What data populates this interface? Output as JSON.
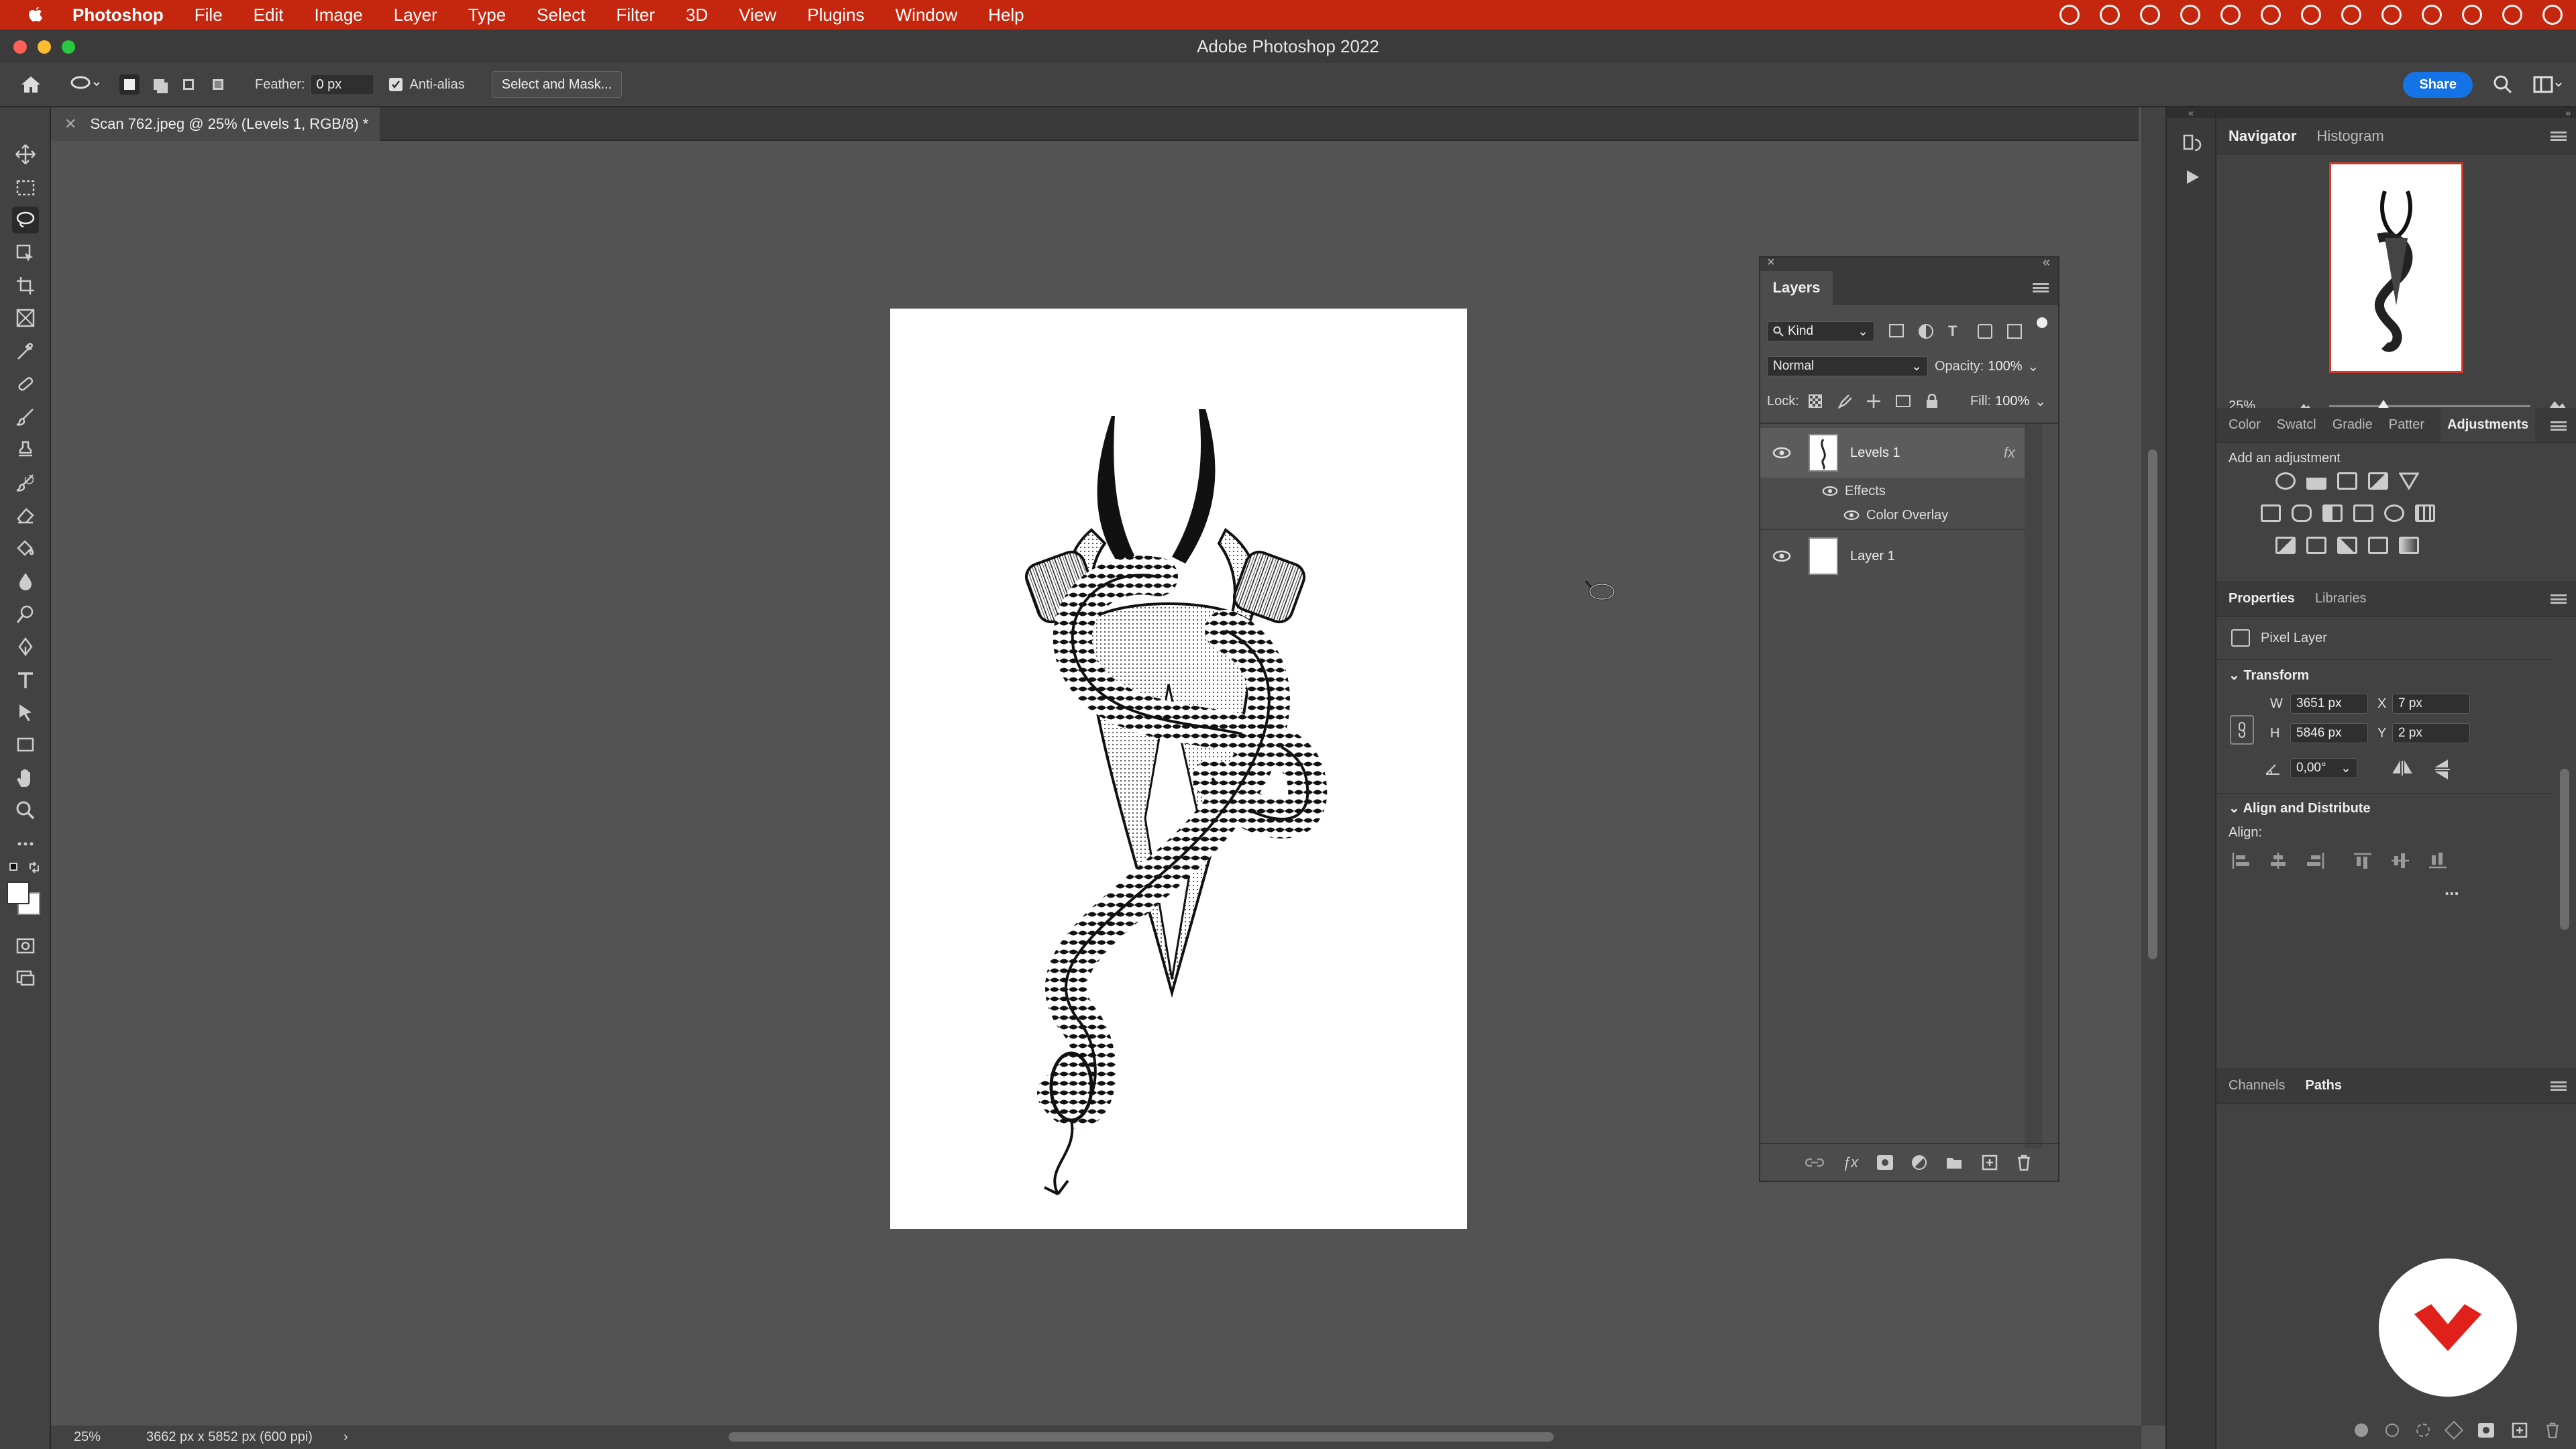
{
  "menubar": {
    "app_name": "Photoshop",
    "items": [
      "File",
      "Edit",
      "Image",
      "Layer",
      "Type",
      "Select",
      "Filter",
      "3D",
      "View",
      "Plugins",
      "Window",
      "Help"
    ]
  },
  "window": {
    "title": "Adobe Photoshop 2022"
  },
  "options": {
    "feather_label": "Feather:",
    "feather_value": "0 px",
    "antialias_label": "Anti-alias",
    "select_mask_label": "Select and Mask...",
    "share_label": "Share"
  },
  "document": {
    "tab_title": "Scan 762.jpeg @ 25% (Levels 1, RGB/8) *",
    "status_zoom": "25%",
    "status_size": "3662 px x 5852 px (600 ppi)"
  },
  "layers_panel": {
    "title": "Layers",
    "filter_kind": "Kind",
    "blend_mode": "Normal",
    "opacity_label": "Opacity:",
    "opacity_value": "100%",
    "lock_label": "Lock:",
    "fill_label": "Fill:",
    "fill_value": "100%",
    "layers": [
      {
        "name": "Levels 1",
        "fx": "fx"
      },
      {
        "name": "Layer 1"
      }
    ],
    "effects_label": "Effects",
    "effect_item": "Color Overlay"
  },
  "navigator": {
    "tabs": [
      "Navigator",
      "Histogram"
    ],
    "zoom": "25%",
    "zoom_fraction": 0.27
  },
  "adjustments": {
    "tabs": [
      "Color",
      "Swatcl",
      "Gradie",
      "Patter",
      "Adjustments"
    ],
    "hint": "Add an adjustment"
  },
  "properties": {
    "tabs": [
      "Properties",
      "Libraries"
    ],
    "kind": "Pixel Layer",
    "transform_label": "Transform",
    "w_label": "W",
    "w_value": "3651 px",
    "h_label": "H",
    "h_value": "5846 px",
    "x_label": "X",
    "x_value": "7 px",
    "y_label": "Y",
    "y_value": "2 px",
    "angle_value": "0,00°",
    "align_distribute_label": "Align and Distribute",
    "align_label": "Align:",
    "more": "..."
  },
  "bottom_panel": {
    "tabs": [
      "Channels",
      "Paths"
    ]
  },
  "colors": {
    "menubar": "#c4260e",
    "accent": "#1473e6",
    "logo": "#e0201b"
  }
}
